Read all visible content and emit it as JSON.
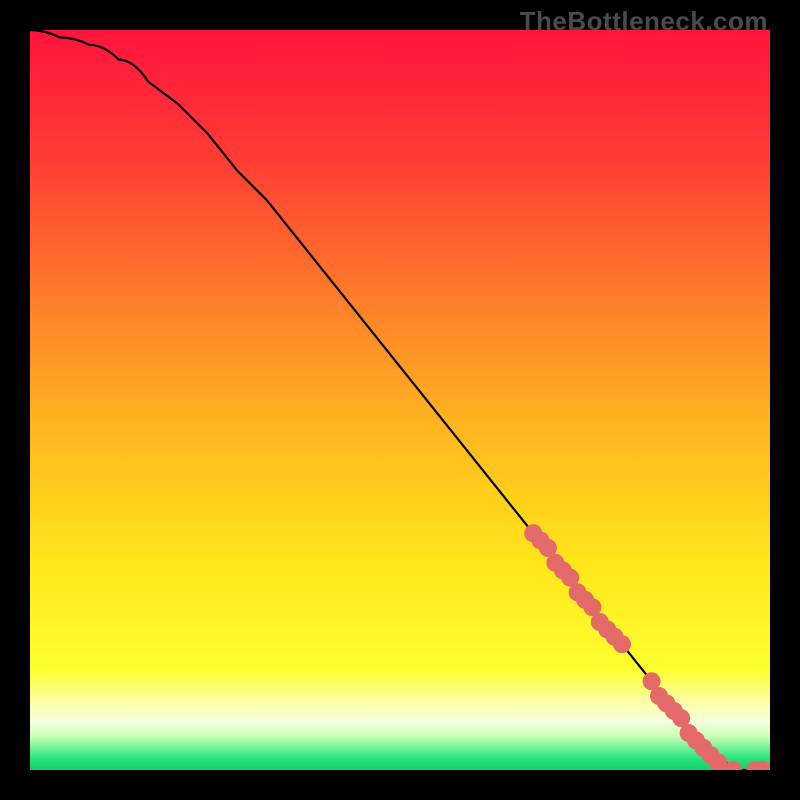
{
  "watermark": "TheBottleneck.com",
  "chart_data": {
    "type": "line",
    "title": "",
    "xlabel": "",
    "ylabel": "",
    "xlim": [
      0,
      100
    ],
    "ylim": [
      0,
      100
    ],
    "grid": false,
    "series": [
      {
        "name": "curve",
        "x": [
          0,
          4,
          8,
          12,
          16,
          20,
          24,
          28,
          32,
          36,
          40,
          44,
          48,
          52,
          56,
          60,
          64,
          68,
          72,
          76,
          80,
          84,
          88,
          90,
          92,
          94,
          96,
          98,
          100
        ],
        "y": [
          100,
          99,
          98,
          96,
          93,
          90,
          86,
          81,
          77,
          72,
          67,
          62,
          57,
          52,
          47,
          42,
          37,
          32,
          27,
          22,
          17,
          12,
          7,
          4,
          2,
          1,
          0,
          0,
          0
        ]
      }
    ],
    "points": {
      "name": "points-on-curve",
      "x": [
        68,
        69,
        70,
        71,
        72,
        73,
        74,
        75,
        76,
        77,
        78,
        79,
        80,
        84,
        85,
        86,
        87,
        88,
        89,
        90,
        91,
        92,
        93,
        95,
        98,
        99
      ],
      "y": [
        32,
        31,
        30,
        28,
        27,
        26,
        24,
        23,
        22,
        20,
        19,
        18,
        17,
        12,
        10,
        9,
        8,
        7,
        5,
        4,
        3,
        2,
        1,
        0,
        0,
        0
      ]
    },
    "background": {
      "type": "custom-gradient",
      "description": "Vertical gradient from red (top) through orange/yellow to thin bright-green band at bottom; narrow white strip just above green.",
      "stops": [
        {
          "pos": 0.0,
          "color": "#ff143c"
        },
        {
          "pos": 0.18,
          "color": "#ff3e34"
        },
        {
          "pos": 0.4,
          "color": "#ff8a28"
        },
        {
          "pos": 0.58,
          "color": "#ffc21e"
        },
        {
          "pos": 0.72,
          "color": "#ffe61a"
        },
        {
          "pos": 0.865,
          "color": "#fdff30"
        },
        {
          "pos": 0.905,
          "color": "#fcffa0"
        },
        {
          "pos": 0.935,
          "color": "#f6ffe0"
        },
        {
          "pos": 0.955,
          "color": "#c8ffb4"
        },
        {
          "pos": 0.968,
          "color": "#7cf59a"
        },
        {
          "pos": 0.985,
          "color": "#27e27a"
        },
        {
          "pos": 1.0,
          "color": "#14d06c"
        }
      ]
    }
  }
}
